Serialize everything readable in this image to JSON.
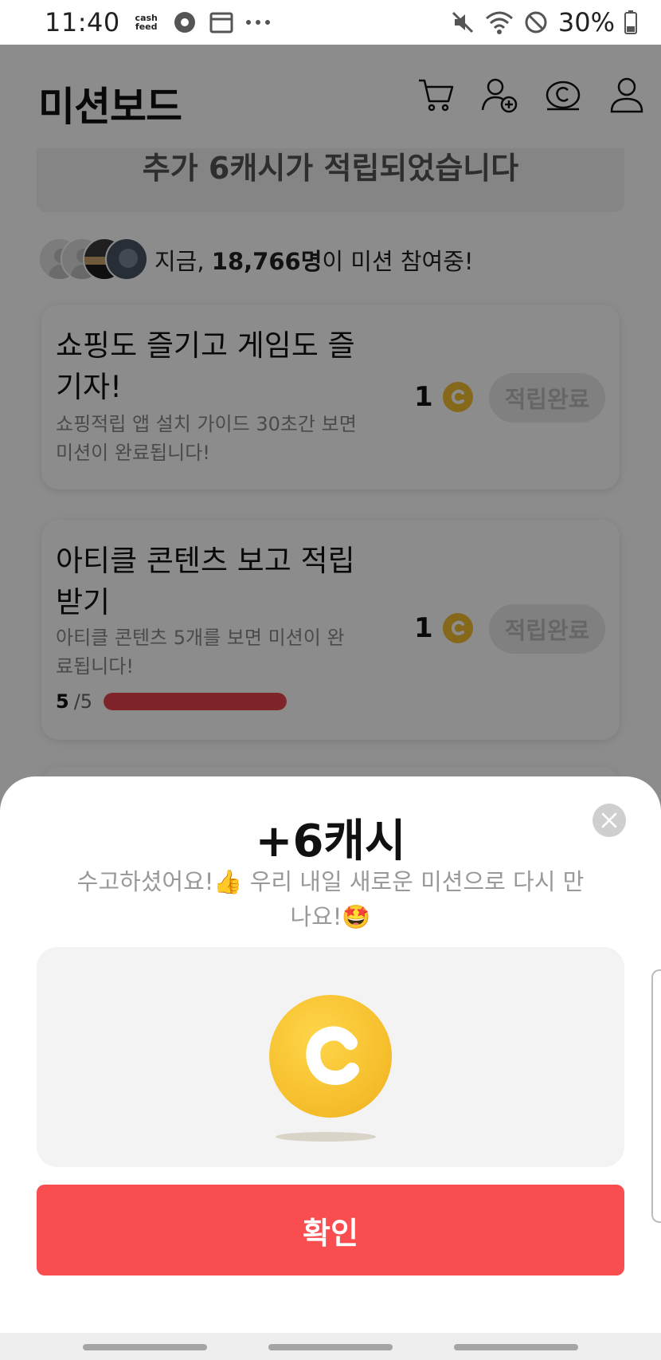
{
  "status_bar": {
    "time": "11:40",
    "app_badge": "cash feed",
    "battery": "30%"
  },
  "header": {
    "title": "미션보드"
  },
  "banner": {
    "text": "추가 6캐시가 적립되었습니다"
  },
  "participants": {
    "prefix": "지금, ",
    "count": "18,766명",
    "suffix": "이 미션 참여중!"
  },
  "missions": [
    {
      "title": "쇼핑도 즐기고 게임도 즐기자!",
      "description": "쇼핑적립 앱 설치 가이드 30초간 보면 미션이 완료됩니다!",
      "reward": "1",
      "button": "적립완료"
    },
    {
      "title": "아티클 콘텐츠 보고 적립 받기",
      "description": "아티클 콘텐츠 5개를 보면 미션이 완료됩니다!",
      "reward": "1",
      "button": "적립완료",
      "progress_current": "5",
      "progress_total": "/5",
      "progress_fraction": 1.0
    }
  ],
  "sheet": {
    "title": "+6캐시",
    "message": "수고하셨어요!👍 우리 내일 새로운 미션으로 다시 만나요!🤩",
    "confirm_label": "확인"
  },
  "colors": {
    "accent": "#fa4d50",
    "coin": "#f6c02e",
    "progress": "#e8434b"
  }
}
